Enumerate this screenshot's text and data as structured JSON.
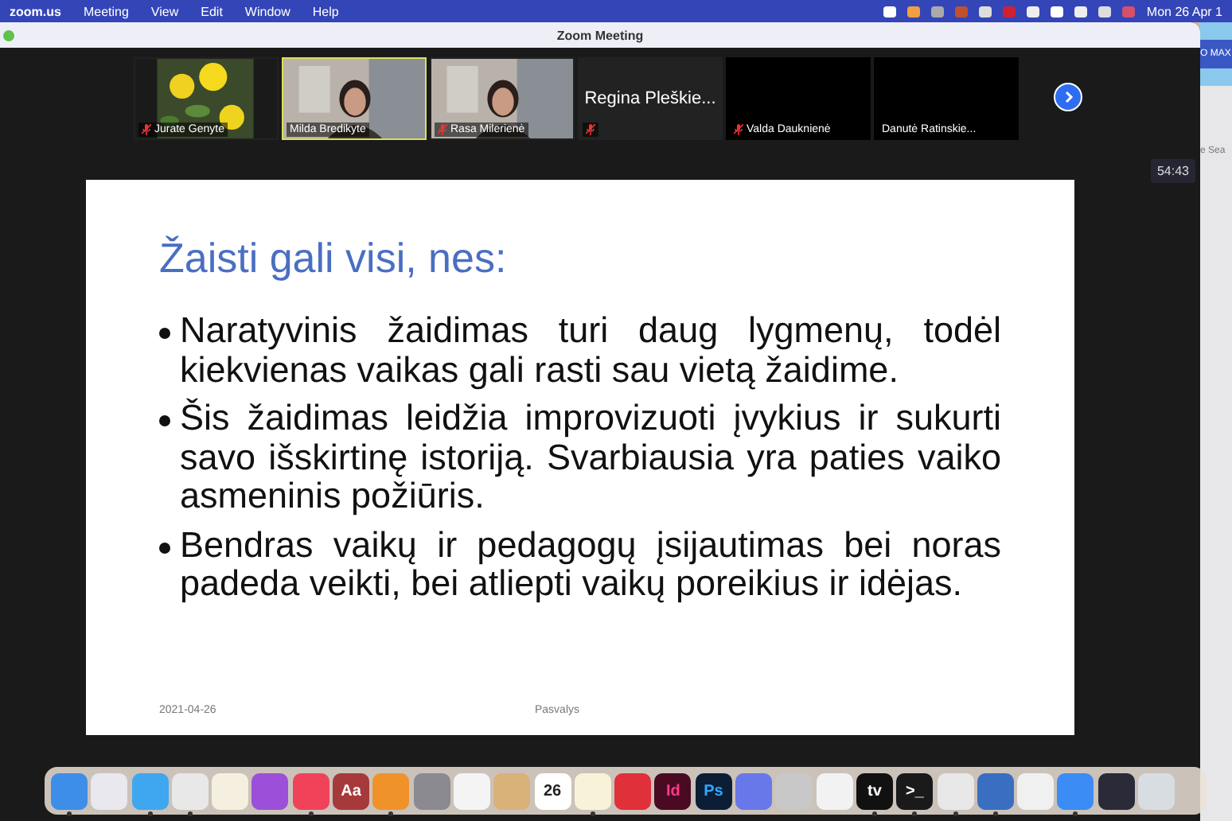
{
  "menu_bar": {
    "app": "zoom.us",
    "items": [
      "Meeting",
      "View",
      "Edit",
      "Window",
      "Help"
    ],
    "clock": "Mon 26 Apr 1"
  },
  "window": {
    "title": "Zoom Meeting",
    "timer": "54:43"
  },
  "participants": [
    {
      "name": "Jurate Genyte",
      "kind": "flowers",
      "selected": false,
      "muted": true
    },
    {
      "name": "Milda Bredikyte",
      "kind": "person",
      "selected": true,
      "muted": false
    },
    {
      "name": "Rasa Milerienė",
      "kind": "person",
      "selected": false,
      "muted": true
    },
    {
      "name": "Regina Pleškie...",
      "kind": "name",
      "selected": false,
      "muted": true
    },
    {
      "name": "Valda Dauknienė",
      "kind": "black",
      "selected": false,
      "muted": true
    },
    {
      "name": "Danutė Ratinskie...",
      "kind": "black",
      "selected": false,
      "muted": false
    }
  ],
  "slide": {
    "title": "Žaisti gali visi, nes:",
    "bullets": [
      "Naratyvinis žaidimas turi daug lygmenų, todėl kiekvienas vaikas gali rasti sau vietą žaidime.",
      "Šis žaidimas leidžia improvizuoti įvykius ir sukurti savo išskirtinę istoriją. Svarbiausia yra paties vaiko asmeninis požiūris.",
      "Bendras vaikų ir pedagogų įsijautimas bei noras padeda veikti, bei atliepti vaikų poreikius ir idėjas."
    ],
    "footer_date": "2021-04-26",
    "footer_place": "Pasvalys"
  },
  "background_window": {
    "texts": [
      "O MAX",
      "e Sea"
    ]
  },
  "dock": [
    {
      "color": "#3d8ee8",
      "running": true
    },
    {
      "color": "#e8e8ee",
      "running": false
    },
    {
      "color": "#3fa6f0",
      "running": true
    },
    {
      "color": "#e8e8e8",
      "running": true
    },
    {
      "color": "#f5efe0",
      "running": false
    },
    {
      "color": "#9c4fd8",
      "running": false
    },
    {
      "color": "#f0435a",
      "running": true
    },
    {
      "color": "#a63a3a",
      "label": "Aa",
      "running": false
    },
    {
      "color": "#f0922a",
      "running": true
    },
    {
      "color": "#8a8a90",
      "running": false
    },
    {
      "color": "#f4f4f4",
      "running": false
    },
    {
      "color": "#d9b27a",
      "running": false
    },
    {
      "color": "#ffffff",
      "label": "26",
      "running": false
    },
    {
      "color": "#f7f2d8",
      "running": true
    },
    {
      "color": "#e0303a",
      "running": false
    },
    {
      "color": "#4a0a22",
      "label": "Id",
      "running": false
    },
    {
      "color": "#0c1e36",
      "label": "Ps",
      "running": false
    },
    {
      "color": "#6878e8",
      "running": false
    },
    {
      "color": "#c8c8c8",
      "running": false
    },
    {
      "color": "#f2f2f2",
      "running": false
    },
    {
      "color": "#111111",
      "label": "tv",
      "running": true
    },
    {
      "color": "#1a1a1a",
      "label": ">_",
      "running": true
    },
    {
      "color": "#e8e8e8",
      "running": true
    },
    {
      "color": "#3a6ec0",
      "running": true
    },
    {
      "color": "#f0f0f0",
      "running": false
    },
    {
      "color": "#3b8cf5",
      "running": true
    },
    {
      "color": "#2a2a38",
      "running": false
    },
    {
      "color": "#d8dde2",
      "running": false
    }
  ]
}
